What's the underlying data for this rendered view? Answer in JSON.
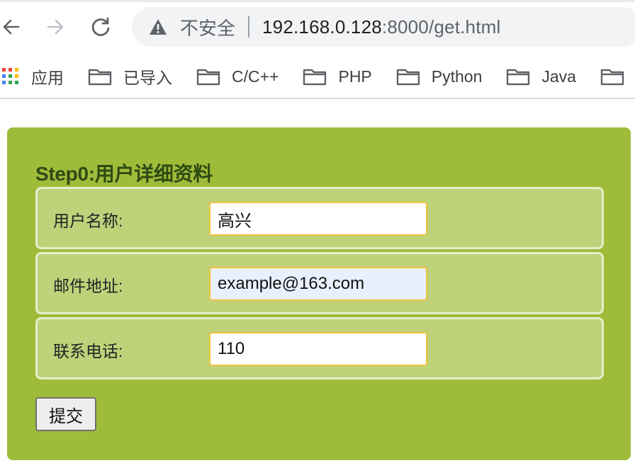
{
  "browser": {
    "back_icon": "arrow-left-icon",
    "forward_icon": "arrow-right-icon",
    "reload_icon": "reload-icon",
    "security_warning": "不安全",
    "url_host": "192.168.0.128",
    "url_rest": ":8000/get.html"
  },
  "bookmarks": [
    {
      "label": "应用",
      "icon": "apps-grid-icon"
    },
    {
      "label": "已导入",
      "icon": "folder-icon"
    },
    {
      "label": "C/C++",
      "icon": "folder-icon"
    },
    {
      "label": "PHP",
      "icon": "folder-icon"
    },
    {
      "label": "Python",
      "icon": "folder-icon"
    },
    {
      "label": "Java",
      "icon": "folder-icon"
    }
  ],
  "form": {
    "title": "Step0:用户详细资料",
    "fields": [
      {
        "label": "用户名称:",
        "value": "高兴"
      },
      {
        "label": "邮件地址:",
        "value": "example@163.com"
      },
      {
        "label": "联系电话:",
        "value": "110"
      }
    ],
    "submit_label": "提交"
  },
  "colors": {
    "panel": "#9ebc3a",
    "row": "#bed27a",
    "title": "#2f4a14",
    "input_border": "#f0c23b",
    "autofill_bg": "#e8f0fe"
  }
}
